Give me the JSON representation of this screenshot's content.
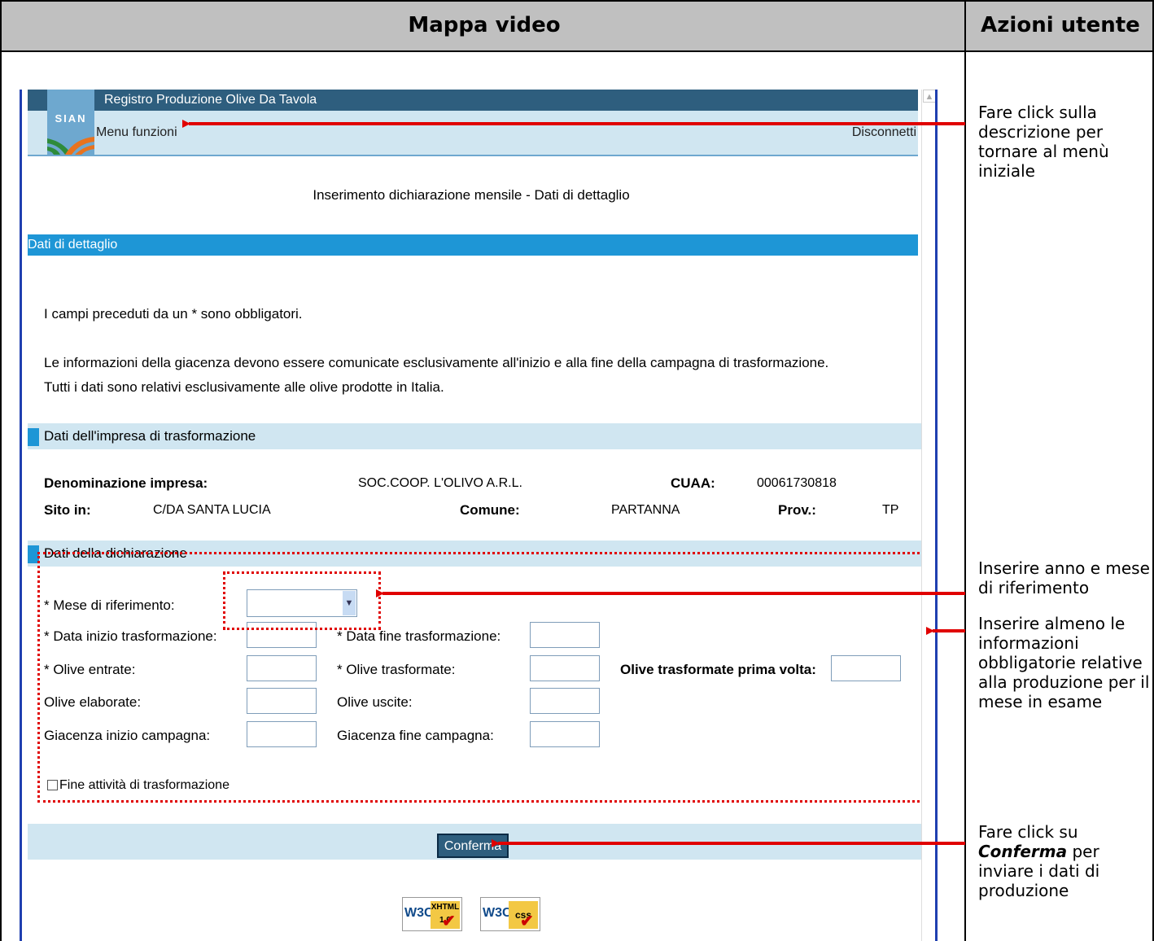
{
  "doc": {
    "col_left": "Mappa video",
    "col_right": "Azioni utente",
    "notes": [
      "Fare click sulla descrizione per tornare al menù iniziale",
      "Inserire anno e mese di riferimento",
      "Inserire almeno le informazioni obbligatorie relative alla produzione per il mese in esame"
    ],
    "note4_pre": "Fare click su ",
    "note4_em": "Conferma",
    "note4_post": " per inviare i dati di produzione"
  },
  "app": {
    "title": "Registro Produzione Olive Da Tavola",
    "logo_text": "SIAN",
    "menu_link": "Menu funzioni",
    "logout_link": "Disconnetti",
    "page_title": "Inserimento dichiarazione mensile - Dati di dettaglio",
    "section_title": "Dati di dettaglio",
    "info_required": "I campi preceduti da un * sono obbligatori.",
    "info_1": "Le informazioni della giacenza devono essere comunicate esclusivamente all'inizio e alla fine della campagna di trasformazione.",
    "info_2": "Tutti i dati sono relativi esclusivamente alle olive prodotte in Italia."
  },
  "impresa": {
    "header": "Dati dell'impresa di trasformazione",
    "denominazione_label": "Denominazione impresa:",
    "denominazione_value": "SOC.COOP. L'OLIVO A.R.L.",
    "cuaa_label": "CUAA:",
    "cuaa_value": "00061730818",
    "sito_label": "Sito in:",
    "sito_value": "C/DA SANTA LUCIA",
    "comune_label": "Comune:",
    "comune_value": "PARTANNA",
    "prov_label": "Prov.:",
    "prov_value": "TP"
  },
  "dichiarazione": {
    "header": "Dati della dichiarazione",
    "mese_label": "* Mese di riferimento:",
    "mese_value": "",
    "data_inizio_label": "* Data inizio trasformazione:",
    "data_fine_label": "* Data fine trasformazione:",
    "olive_entrate_label": "* Olive entrate:",
    "olive_trasformate_label": "* Olive trasformate:",
    "olive_prima_volta_label": "Olive trasformate prima volta:",
    "olive_elaborate_label": "Olive elaborate:",
    "olive_uscite_label": "Olive uscite:",
    "giacenza_inizio_label": "Giacenza inizio campagna:",
    "giacenza_fine_label": "Giacenza fine campagna:",
    "fine_attivita_label": "Fine attività di trasformazione",
    "confirm_label": "Conferma"
  },
  "badges": {
    "xhtml_w3c": "W3C",
    "xhtml_label": "XHTML 1.0",
    "css_w3c": "W3C",
    "css_label": "css"
  },
  "colors": {
    "annotation_red": "#e00000",
    "header_blue": "#2e5e7e",
    "section_blue": "#1e96d6",
    "light_blue": "#d0e6f1"
  }
}
